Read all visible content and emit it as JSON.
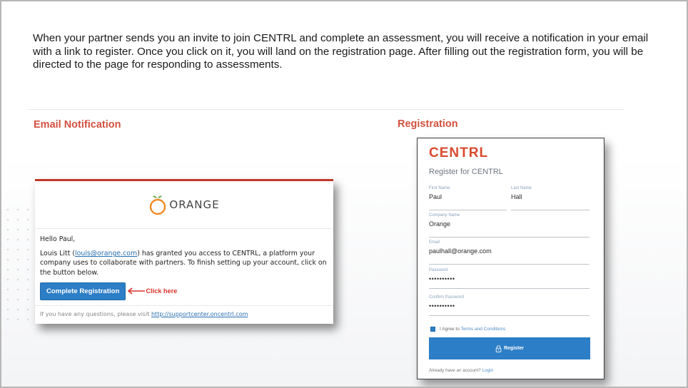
{
  "intro_text": "When your partner sends you an invite to join CENTRL and complete an assessment, you will receive a notification in your email with a link to register. Once you click on it, you will land on the registration page. After filling out the registration form, you will be directed to the page for responding to assessments.",
  "sections": {
    "email_label": "Email Notification",
    "registration_label": "Registration"
  },
  "email": {
    "brand_name": "ORANGE",
    "greeting": "Hello Paul,",
    "body_prefix": "Louis Litt (",
    "sender_email": "louis@orange.com",
    "body_suffix": ") has granted you access to CENTRL, a platform your company uses to collaborate with partners. To finish setting up your account, click on the button below.",
    "cta_label": "Complete Registration",
    "annotation": "Click here",
    "footer_prefix": "If you have any questions, please visit ",
    "footer_link": "http://supportcenter.oncentrl.com",
    "colors": {
      "accent": "#c0392b",
      "button": "#2c7ec6",
      "annotation": "#d9332b"
    }
  },
  "registration": {
    "logo": "CENTRL",
    "title": "Register for CENTRL",
    "fields": {
      "first_name": {
        "label": "First Name",
        "value": "Paul"
      },
      "last_name": {
        "label": "Last Name",
        "value": "Hall"
      },
      "company": {
        "label": "Company Name",
        "value": "Orange"
      },
      "email": {
        "label": "Email",
        "value": "paulhall@orange.com"
      },
      "password": {
        "label": "Password",
        "value": "••••••••••"
      },
      "confirm_password": {
        "label": "Confirm Password",
        "value": "••••••••••"
      }
    },
    "agree_prefix": "I Agree to ",
    "agree_link": "Terms and Conditions",
    "agree_checked": true,
    "register_label": "Register",
    "footer_prefix": "Already have an account? ",
    "footer_link": "Login",
    "colors": {
      "logo": "#d94a2f",
      "button": "#2c7ec6"
    }
  }
}
